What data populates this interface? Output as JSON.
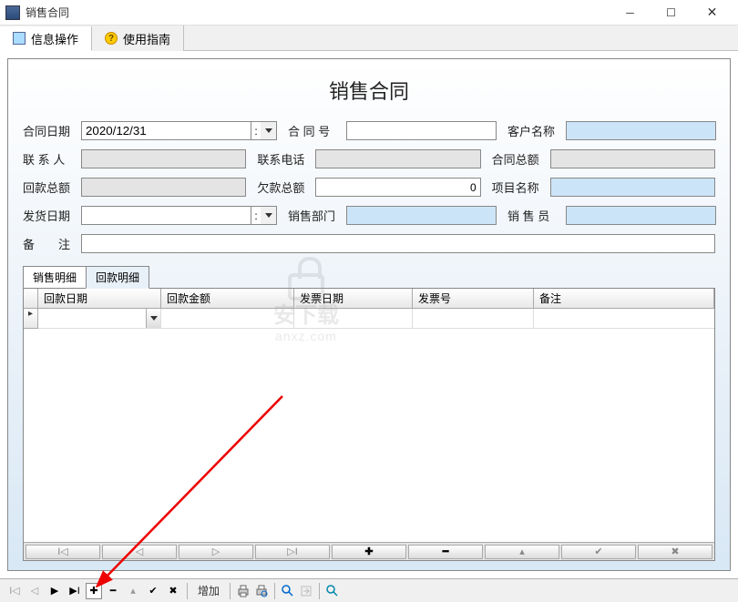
{
  "window": {
    "title": "销售合同"
  },
  "tabs": {
    "info": "信息操作",
    "guide": "使用指南"
  },
  "page_title": "销售合同",
  "form": {
    "contract_date_label": "合同日期",
    "contract_date_value": "2020/12/31",
    "contract_no_label": "合 同 号",
    "contract_no_value": "",
    "customer_name_label": "客户名称",
    "customer_name_value": "",
    "contact_label": "联 系 人",
    "contact_value": "",
    "phone_label": "联系电话",
    "phone_value": "",
    "contract_total_label": "合同总额",
    "contract_total_value": "",
    "repay_total_label": "回款总额",
    "repay_total_value": "",
    "debt_total_label": "欠款总额",
    "debt_total_value": "0",
    "project_name_label": "项目名称",
    "project_name_value": "",
    "ship_date_label": "发货日期",
    "ship_date_value": "",
    "sales_dept_label": "销售部门",
    "sales_dept_value": "",
    "salesperson_label": "销 售 员",
    "salesperson_value": "",
    "remark_label": "备　　注",
    "remark_value": ""
  },
  "subtabs": {
    "sales_detail": "销售明细",
    "repay_detail": "回款明细"
  },
  "grid": {
    "columns": [
      "回款日期",
      "回款金额",
      "发票日期",
      "发票号",
      "备注"
    ]
  },
  "grid_nav": {
    "first": "⊳|",
    "prev": "◁",
    "next": "▷",
    "last": "|⊲",
    "add": "✚",
    "delete": "━",
    "edit": "▴",
    "post": "✔",
    "cancel": "✖"
  },
  "toolbar": {
    "add_text": "增加"
  },
  "watermark": {
    "line1": "安下载",
    "line2": "anxz.com"
  }
}
